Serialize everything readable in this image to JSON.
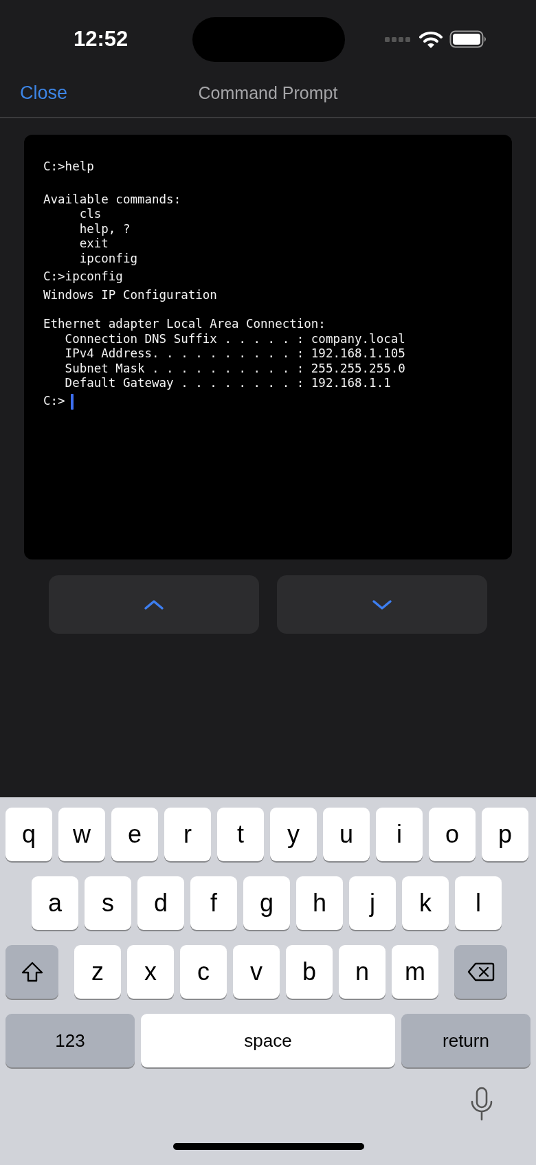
{
  "status_bar": {
    "time": "12:52"
  },
  "nav": {
    "close": "Close",
    "title": "Command Prompt"
  },
  "terminal": {
    "entries": [
      {
        "kind": "command",
        "text": "C:>help"
      },
      {
        "kind": "blank"
      },
      {
        "kind": "output",
        "text": "Available commands:"
      },
      {
        "kind": "output",
        "text": "     cls"
      },
      {
        "kind": "output",
        "text": "     help, ?"
      },
      {
        "kind": "output",
        "text": "     exit"
      },
      {
        "kind": "output",
        "text": "     ipconfig"
      },
      {
        "kind": "command",
        "text": "C:>ipconfig"
      },
      {
        "kind": "output",
        "text": "Windows IP Configuration"
      },
      {
        "kind": "blank"
      },
      {
        "kind": "output",
        "text": "Ethernet adapter Local Area Connection:"
      },
      {
        "kind": "output",
        "text": "   Connection DNS Suffix . . . . . : company.local"
      },
      {
        "kind": "output",
        "text": "   IPv4 Address. . . . . . . . . . : 192.168.1.105"
      },
      {
        "kind": "output",
        "text": "   Subnet Mask . . . . . . . . . . : 255.255.255.0"
      },
      {
        "kind": "output",
        "text": "   Default Gateway . . . . . . . . : 192.168.1.1"
      }
    ],
    "prompt": "C:>",
    "cursor": true
  },
  "history_buttons": [
    {
      "kind": "up"
    },
    {
      "kind": "down"
    }
  ],
  "keyboard": {
    "rows": [
      [
        {
          "kind": "letter",
          "label": "q"
        },
        {
          "kind": "letter",
          "label": "w"
        },
        {
          "kind": "letter",
          "label": "e"
        },
        {
          "kind": "letter",
          "label": "r"
        },
        {
          "kind": "letter",
          "label": "t"
        },
        {
          "kind": "letter",
          "label": "y"
        },
        {
          "kind": "letter",
          "label": "u"
        },
        {
          "kind": "letter",
          "label": "i"
        },
        {
          "kind": "letter",
          "label": "o"
        },
        {
          "kind": "letter",
          "label": "p"
        }
      ],
      [
        {
          "kind": "letter",
          "label": "a"
        },
        {
          "kind": "letter",
          "label": "s"
        },
        {
          "kind": "letter",
          "label": "d"
        },
        {
          "kind": "letter",
          "label": "f"
        },
        {
          "kind": "letter",
          "label": "g"
        },
        {
          "kind": "letter",
          "label": "h"
        },
        {
          "kind": "letter",
          "label": "j"
        },
        {
          "kind": "letter",
          "label": "k"
        },
        {
          "kind": "letter",
          "label": "l"
        }
      ],
      [
        {
          "kind": "shift"
        },
        {
          "kind": "letter",
          "label": "z"
        },
        {
          "kind": "letter",
          "label": "x"
        },
        {
          "kind": "letter",
          "label": "c"
        },
        {
          "kind": "letter",
          "label": "v"
        },
        {
          "kind": "letter",
          "label": "b"
        },
        {
          "kind": "letter",
          "label": "n"
        },
        {
          "kind": "letter",
          "label": "m"
        },
        {
          "kind": "delete"
        }
      ]
    ],
    "bottom_bar": {
      "numbers": "123",
      "space": "space",
      "return": "return"
    }
  }
}
